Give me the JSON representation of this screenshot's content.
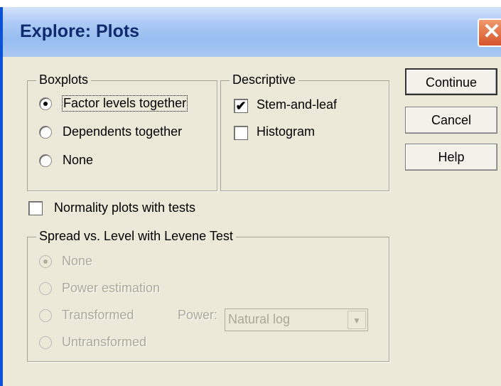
{
  "window": {
    "title": "Explore: Plots",
    "close_glyph": "✕"
  },
  "boxplots": {
    "legend": "Boxplots",
    "options": [
      "Factor levels together",
      "Dependents together",
      "None"
    ],
    "selected_index": 0
  },
  "descriptive": {
    "legend": "Descriptive",
    "stem_and_leaf": {
      "label": "Stem-and-leaf",
      "checked": true
    },
    "histogram": {
      "label": "Histogram",
      "checked": false
    }
  },
  "buttons": {
    "continue": "Continue",
    "cancel": "Cancel",
    "help": "Help"
  },
  "normality": {
    "label": "Normality plots with tests",
    "checked": false
  },
  "spread": {
    "legend": "Spread vs. Level with Levene Test",
    "options": [
      "None",
      "Power estimation",
      "Transformed",
      "Untransformed"
    ],
    "selected_index": 0,
    "enabled": false,
    "power_label": "Power:",
    "power_value": "Natural log"
  },
  "glyphs": {
    "check_mark": "✔",
    "dropdown_arrow": "▼"
  }
}
